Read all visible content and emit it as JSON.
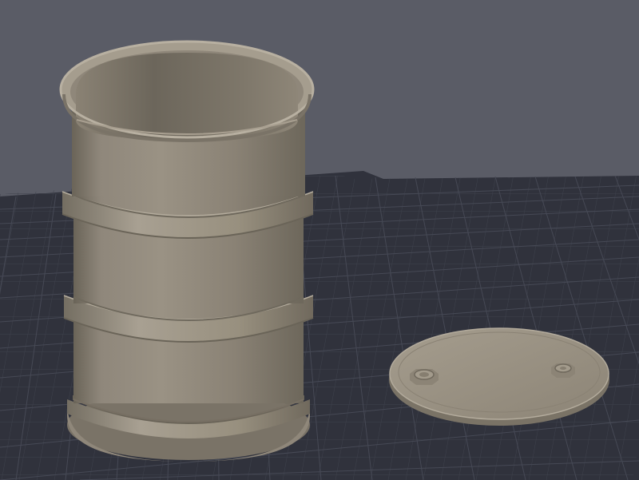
{
  "viewport": {
    "background_color": "#5a5c66",
    "build_plate_color": "#30323c",
    "grid_minor_color": "#3c3f4a",
    "grid_major_color": "#4a4d59"
  },
  "objects": [
    {
      "name": "oil-drum",
      "kind": "model",
      "body_color": "#8f877b",
      "highlight_color": "#b0a899",
      "shadow_color": "#6a6458",
      "rib_count": 2
    },
    {
      "name": "drum-lid",
      "kind": "model",
      "top_color": "#9a9283",
      "edge_color": "#7a7366",
      "bung_count": 2
    }
  ]
}
